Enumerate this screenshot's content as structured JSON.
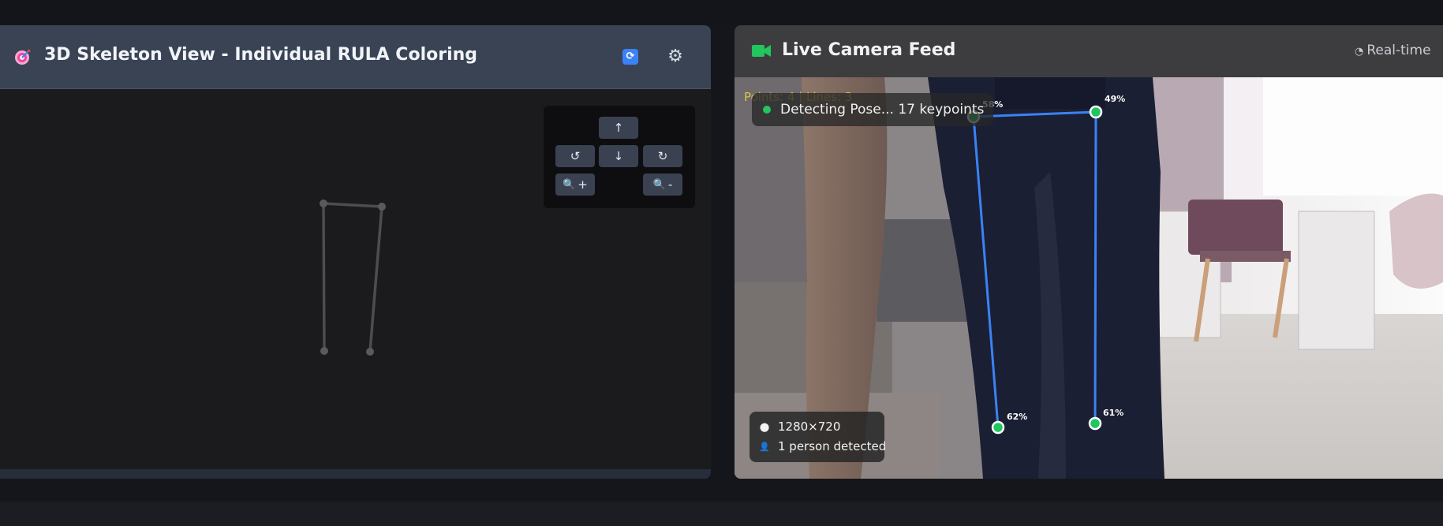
{
  "skeleton_panel": {
    "title": "3D Skeleton View - Individual RULA Coloring",
    "title_icon": "target-icon",
    "refresh_icon": "refresh-icon",
    "settings_icon": "gear-icon",
    "controls": {
      "up": "↑",
      "rotate_left": "↺",
      "down": "↓",
      "rotate_right": "↻",
      "zoom_in": "+",
      "zoom_out": "-"
    }
  },
  "camera_panel": {
    "title": "Live Camera Feed",
    "title_icon": "video-camera-icon",
    "realtime_label": "Real-time",
    "overlay_stats": "Points: 4 | Lines: 3",
    "status_text": "Detecting Pose... 17 keypoints",
    "resolution": "1280×720",
    "persons": "1 person detected",
    "keypoints": [
      {
        "label": "58%"
      },
      {
        "label": "49%"
      },
      {
        "label": "62%"
      },
      {
        "label": "61%"
      }
    ]
  },
  "colors": {
    "accent_green": "#22c55e",
    "pose_line_blue": "#3b82f6",
    "header_slate": "#394354"
  }
}
